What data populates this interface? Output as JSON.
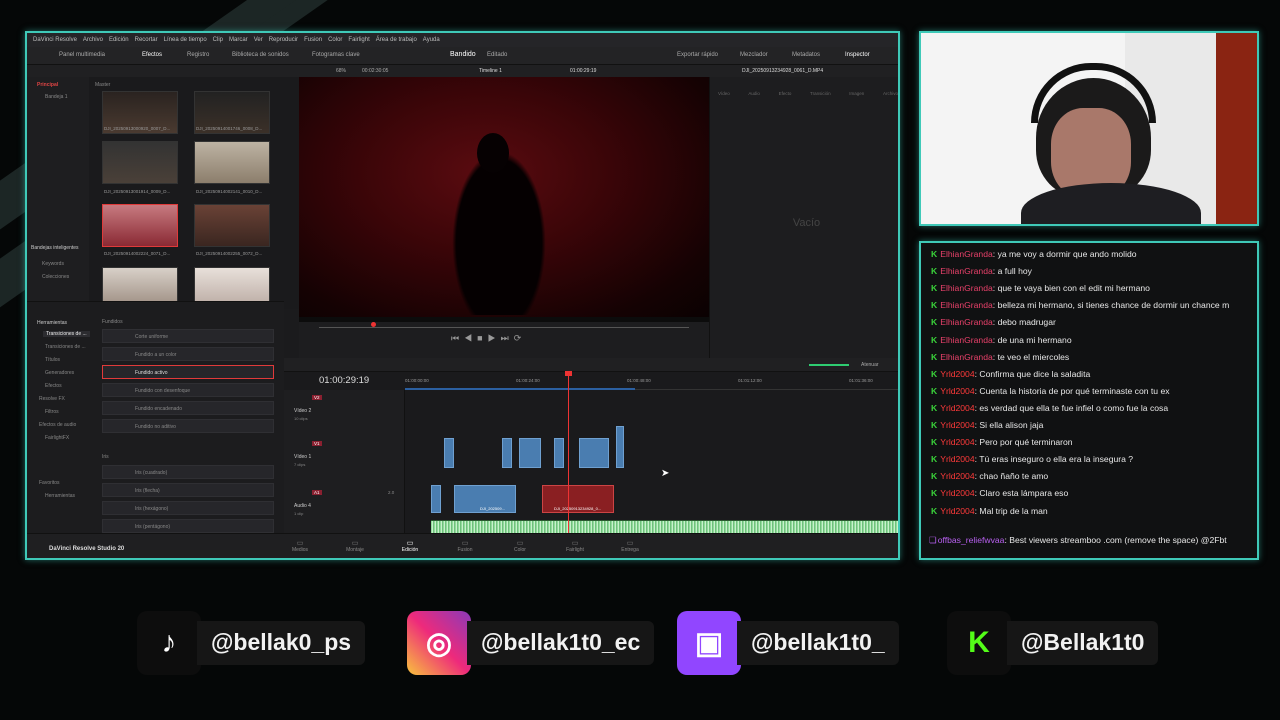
{
  "resolve": {
    "menu": [
      "DaVinci Resolve",
      "Archivo",
      "Edición",
      "Recortar",
      "Línea de tiempo",
      "Clip",
      "Marcar",
      "Ver",
      "Reproducir",
      "Fusion",
      "Color",
      "Fairlight",
      "Área de trabajo",
      "Ayuda"
    ],
    "toolbar": {
      "media_pool": "Panel multimedia",
      "effects": "Efectos",
      "index": "Registro",
      "sound_library": "Biblioteca de sonidos",
      "keyframes": "Fotogramas clave",
      "project": "Bandido",
      "project_status": "Editado",
      "quick_export": "Exportar rápido",
      "mixer": "Mezclador",
      "metadata": "Metadatos",
      "inspector": "Inspector"
    },
    "viewer_bar": {
      "zoom": "68%",
      "src_tc": "00:02:30:05",
      "timeline": "Timeline 1",
      "tc": "01:00:29:19",
      "clip_name": "DJI_20250913234928_0061_D.MP4"
    },
    "media_pool": {
      "principal": "Principal",
      "bin": "Bandeja 1",
      "master": "Master",
      "smart_bins": "Bandejas inteligentes",
      "keywords": "Keywords",
      "collections": "Colecciones",
      "clips": [
        "DJI_20250913000920_0007_D...",
        "DJI_20250914001746_0008_D...",
        "DJI_20250913001914_0009_D...",
        "DJI_20250914002141_0010_D...",
        "DJI_20250914002224_0071_D...",
        "DJI_20250914002255_0072_D...",
        "",
        ""
      ]
    },
    "effects": {
      "toolbox": "Herramientas",
      "video_transitions": "Transiciones de ...",
      "audio_transitions": "Transiciones de ...",
      "titles": "Títulos",
      "generators": "Generadores",
      "effects": "Efectos",
      "resolve_fx": "Resolve FX",
      "filters": "Filtros",
      "audio_effects": "Efectos de audio",
      "fairlight_fx": "FairlightFX",
      "favorites": "Favoritos",
      "tools": "Herramientas",
      "group_fades": "Fundidos",
      "fades": [
        "Corte uniforme",
        "Fundido a un color",
        "Fundido activo",
        "Fundido con desenfoque",
        "Fundido encadenado",
        "Fundido no aditivo"
      ],
      "group_iris": "Iris",
      "iris": [
        "Iris (cuadrado)",
        "Iris (flecha)",
        "Iris (hexágono)",
        "Iris (pentágono)"
      ]
    },
    "inspector": {
      "tabs": [
        "Vídeo",
        "Audio",
        "Efecto",
        "Transición",
        "Imagen",
        "Archivo"
      ],
      "empty": "Vacío"
    },
    "timeline": {
      "timecode": "01:00:29:19",
      "ruler": [
        "01:00:00:00",
        "01:00:24:00",
        "01:00:48:00",
        "01:01:12:00",
        "01:01:36:00"
      ],
      "attenuate": "Atenuar",
      "tracks": [
        {
          "id": "V2",
          "name": "Vídeo 2",
          "clips": "10 clips"
        },
        {
          "id": "V1",
          "name": "Vídeo 1",
          "clips": "7 clips"
        },
        {
          "id": "A1",
          "name": "Audio 4",
          "clips": "1 clip",
          "level": "2.0"
        }
      ],
      "v1_clip_a": "DJI_202509...",
      "v1_clip_b": "DJI_20250913234928_0...",
      "audio_clip": "BANDIDO MASTER FINAL - 8 LUFS.wav"
    },
    "pages": [
      "Medios",
      "Montaje",
      "Edición",
      "Fusion",
      "Color",
      "Fairlight",
      "Entrega"
    ],
    "active_page": "Edición",
    "product": "DaVinci Resolve Studio 20"
  },
  "chat": {
    "lines": [
      {
        "user": "ElhianGranda",
        "text": "ya me voy a dormir que ando molido",
        "color": "u1"
      },
      {
        "user": "ElhianGranda",
        "text": "a full hoy",
        "color": "u1"
      },
      {
        "user": "ElhianGranda",
        "text": "que te vaya bien con el edit mi hermano",
        "color": "u1"
      },
      {
        "user": "ElhianGranda",
        "text": "belleza mi hermano, si tienes chance de dormir un chance m",
        "color": "u1"
      },
      {
        "user": "ElhianGranda",
        "text": "debo madrugar",
        "color": "u1"
      },
      {
        "user": "ElhianGranda",
        "text": "de una mi hermano",
        "color": "u1"
      },
      {
        "user": "ElhianGranda",
        "text": "te veo el miercoles",
        "color": "u1"
      },
      {
        "user": "Yrld2004",
        "text": "Confirma que dice la saladita",
        "color": "u2"
      },
      {
        "user": "Yrld2004",
        "text": "Cuenta la historia de por qué terminaste con tu ex",
        "color": "u2"
      },
      {
        "user": "Yrld2004",
        "text": "es verdad que ella te fue infiel o como fue la cosa",
        "color": "u2"
      },
      {
        "user": "Yrld2004",
        "text": "Si ella alison jaja",
        "color": "u2"
      },
      {
        "user": "Yrld2004",
        "text": "Pero por qué terminaron",
        "color": "u2"
      },
      {
        "user": "Yrld2004",
        "text": "Tú eras inseguro o ella era la insegura ?",
        "color": "u2"
      },
      {
        "user": "Yrld2004",
        "text": "chao ñaño te amo",
        "color": "u2"
      },
      {
        "user": "Yrld2004",
        "text": "Claro esta lámpara eso",
        "color": "u2"
      },
      {
        "user": "Yrld2004",
        "text": "Mal trip de la man",
        "color": "u2"
      }
    ],
    "spam": {
      "user": "offbas_reliefwvaa",
      "text": "Best viewers streamboo .com (remove the space) @2Fbt"
    }
  },
  "socials": [
    {
      "icon": "tiktok-icon",
      "handle": "@bellak0_ps"
    },
    {
      "icon": "instagram-icon",
      "handle": "@bellak1t0_ec"
    },
    {
      "icon": "twitch-icon",
      "handle": "@bellak1t0_"
    },
    {
      "icon": "kick-icon",
      "handle": "@Bellak1t0"
    }
  ],
  "colors": {
    "frame": "#3fc9b8",
    "kick": "#53fc18",
    "twitch": "#9146ff",
    "selection": "#e03a3a"
  }
}
